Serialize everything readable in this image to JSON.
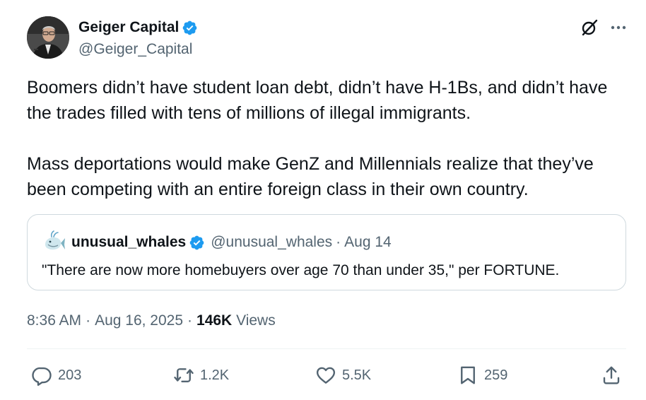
{
  "author": {
    "display_name": "Geiger Capital",
    "handle": "@Geiger_Capital",
    "verified": true
  },
  "tweet": {
    "paragraphs": [
      "Boomers didn’t have student loan debt, didn’t have H-1Bs, and didn’t have the trades filled with tens of millions of illegal immigrants.",
      "Mass deportations would make GenZ and Millennials realize that they’ve been competing with an entire foreign class in their own country."
    ]
  },
  "quote": {
    "display_name": "unusual_whales",
    "handle": "@unusual_whales",
    "separator": "·",
    "date": "Aug 14",
    "text": "\"There are now more homebuyers over age 70 than under 35,\" per FORTUNE."
  },
  "meta": {
    "time": "8:36 AM",
    "date": "Aug 16, 2025",
    "separator": "·",
    "views_count": "146K",
    "views_label": "Views"
  },
  "actions": {
    "replies": "203",
    "reposts": "1.2K",
    "likes": "5.5K",
    "bookmarks": "259"
  },
  "colors": {
    "text": "#0f1419",
    "secondary": "#536471",
    "verified": "#1d9bf0",
    "border": "#cfd9de",
    "divider": "#eff3f4"
  },
  "icons": [
    "grok-icon",
    "more-icon",
    "verified-icon",
    "reply-icon",
    "repost-icon",
    "like-icon",
    "bookmark-icon",
    "share-icon"
  ]
}
